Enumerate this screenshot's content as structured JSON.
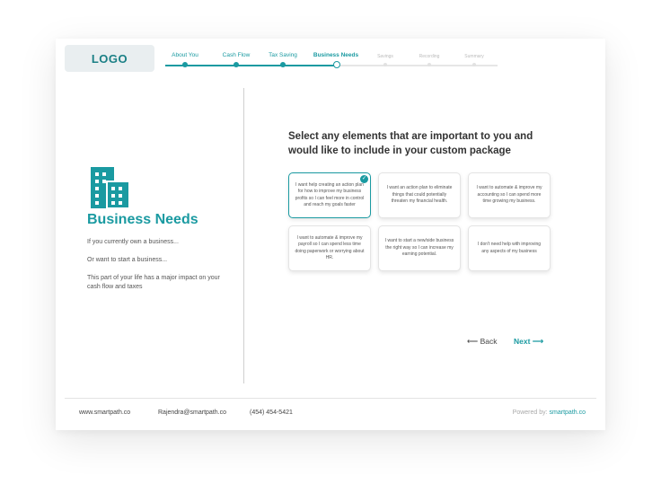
{
  "header": {
    "logo": "LOGO",
    "steps": [
      {
        "label": "About You",
        "state": "done"
      },
      {
        "label": "Cash Flow",
        "state": "done"
      },
      {
        "label": "Tax Saving",
        "state": "done"
      },
      {
        "label": "Business Needs",
        "state": "active"
      },
      {
        "label": "Savings",
        "state": "future"
      },
      {
        "label": "Recording",
        "state": "future"
      },
      {
        "label": "Summary",
        "state": "future"
      }
    ]
  },
  "left": {
    "icon": "building-icon",
    "title": "Business Needs",
    "line1": "If you currently own a business...",
    "line2": "Or want to start a business...",
    "line3": "This part of your life has a major impact on your cash flow and taxes"
  },
  "main": {
    "question": "Select any elements that are important to you and would like to include in your custom package",
    "options": [
      {
        "text": "I want help creating an action plan for how to improve my business profits so I can feel more in control and reach my goals faster",
        "selected": true
      },
      {
        "text": "I want an action plan to eliminate things that could potentially threaten my financial health.",
        "selected": false
      },
      {
        "text": "I want to automate & improve my accounting so I can spend more time growing my business.",
        "selected": false
      },
      {
        "text": "I want to automate & improve my payroll so I can spend less time doing paperwork or worrying about HR.",
        "selected": false
      },
      {
        "text": "I want to start a new/side business the right way so I can increase my earning potential.",
        "selected": false
      },
      {
        "text": "I don't need help with improving any aspects of my business",
        "selected": false
      }
    ],
    "back_label": "Back",
    "next_label": "Next"
  },
  "footer": {
    "website": "www.smartpath.co",
    "email": "Rajendra@smartpath.co",
    "phone": "(454) 454-5421",
    "powered_prefix": "Powered by:",
    "powered_brand": "smartpath.co"
  },
  "colors": {
    "accent": "#1a9aa1",
    "muted": "#e6e6e6"
  }
}
